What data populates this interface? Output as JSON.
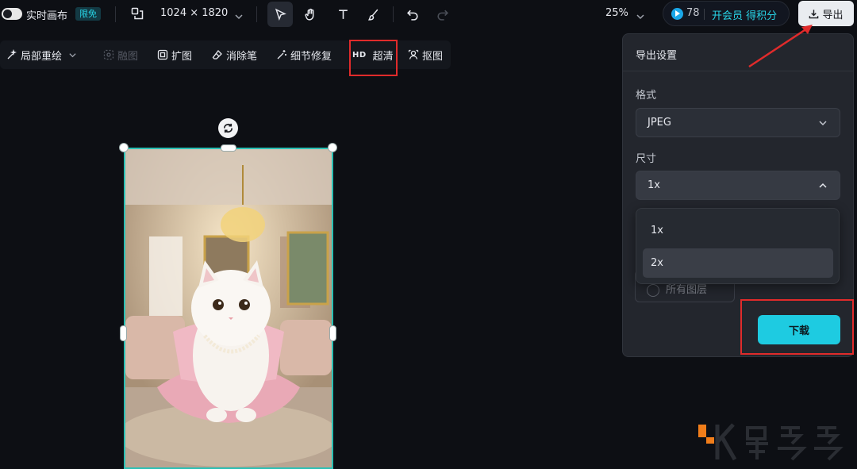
{
  "topbar": {
    "live_canvas_label": "实时画布",
    "live_canvas_badge": "限免",
    "canvas_size": "1024 × 1820",
    "zoom": "25%",
    "points_value": "78",
    "membership_label": "开会员 得积分",
    "export_label": "导出"
  },
  "toolbar2": {
    "items": [
      {
        "label": "局部重绘"
      },
      {
        "label": "融图"
      },
      {
        "label": "扩图"
      },
      {
        "label": "消除笔"
      },
      {
        "label": "细节修复"
      },
      {
        "label": "超清",
        "prefix": "HD"
      },
      {
        "label": "抠图"
      }
    ]
  },
  "export_panel": {
    "title": "导出设置",
    "format_label": "格式",
    "format_value": "JPEG",
    "size_label": "尺寸",
    "size_value": "1x",
    "size_options": [
      "1x",
      "2x"
    ],
    "layers_option": "所有图层",
    "download_label": "下载"
  },
  "colors": {
    "accent": "#1ecbe1",
    "annotation_red": "#e02b2b",
    "selection_border": "#2bc0b4"
  }
}
